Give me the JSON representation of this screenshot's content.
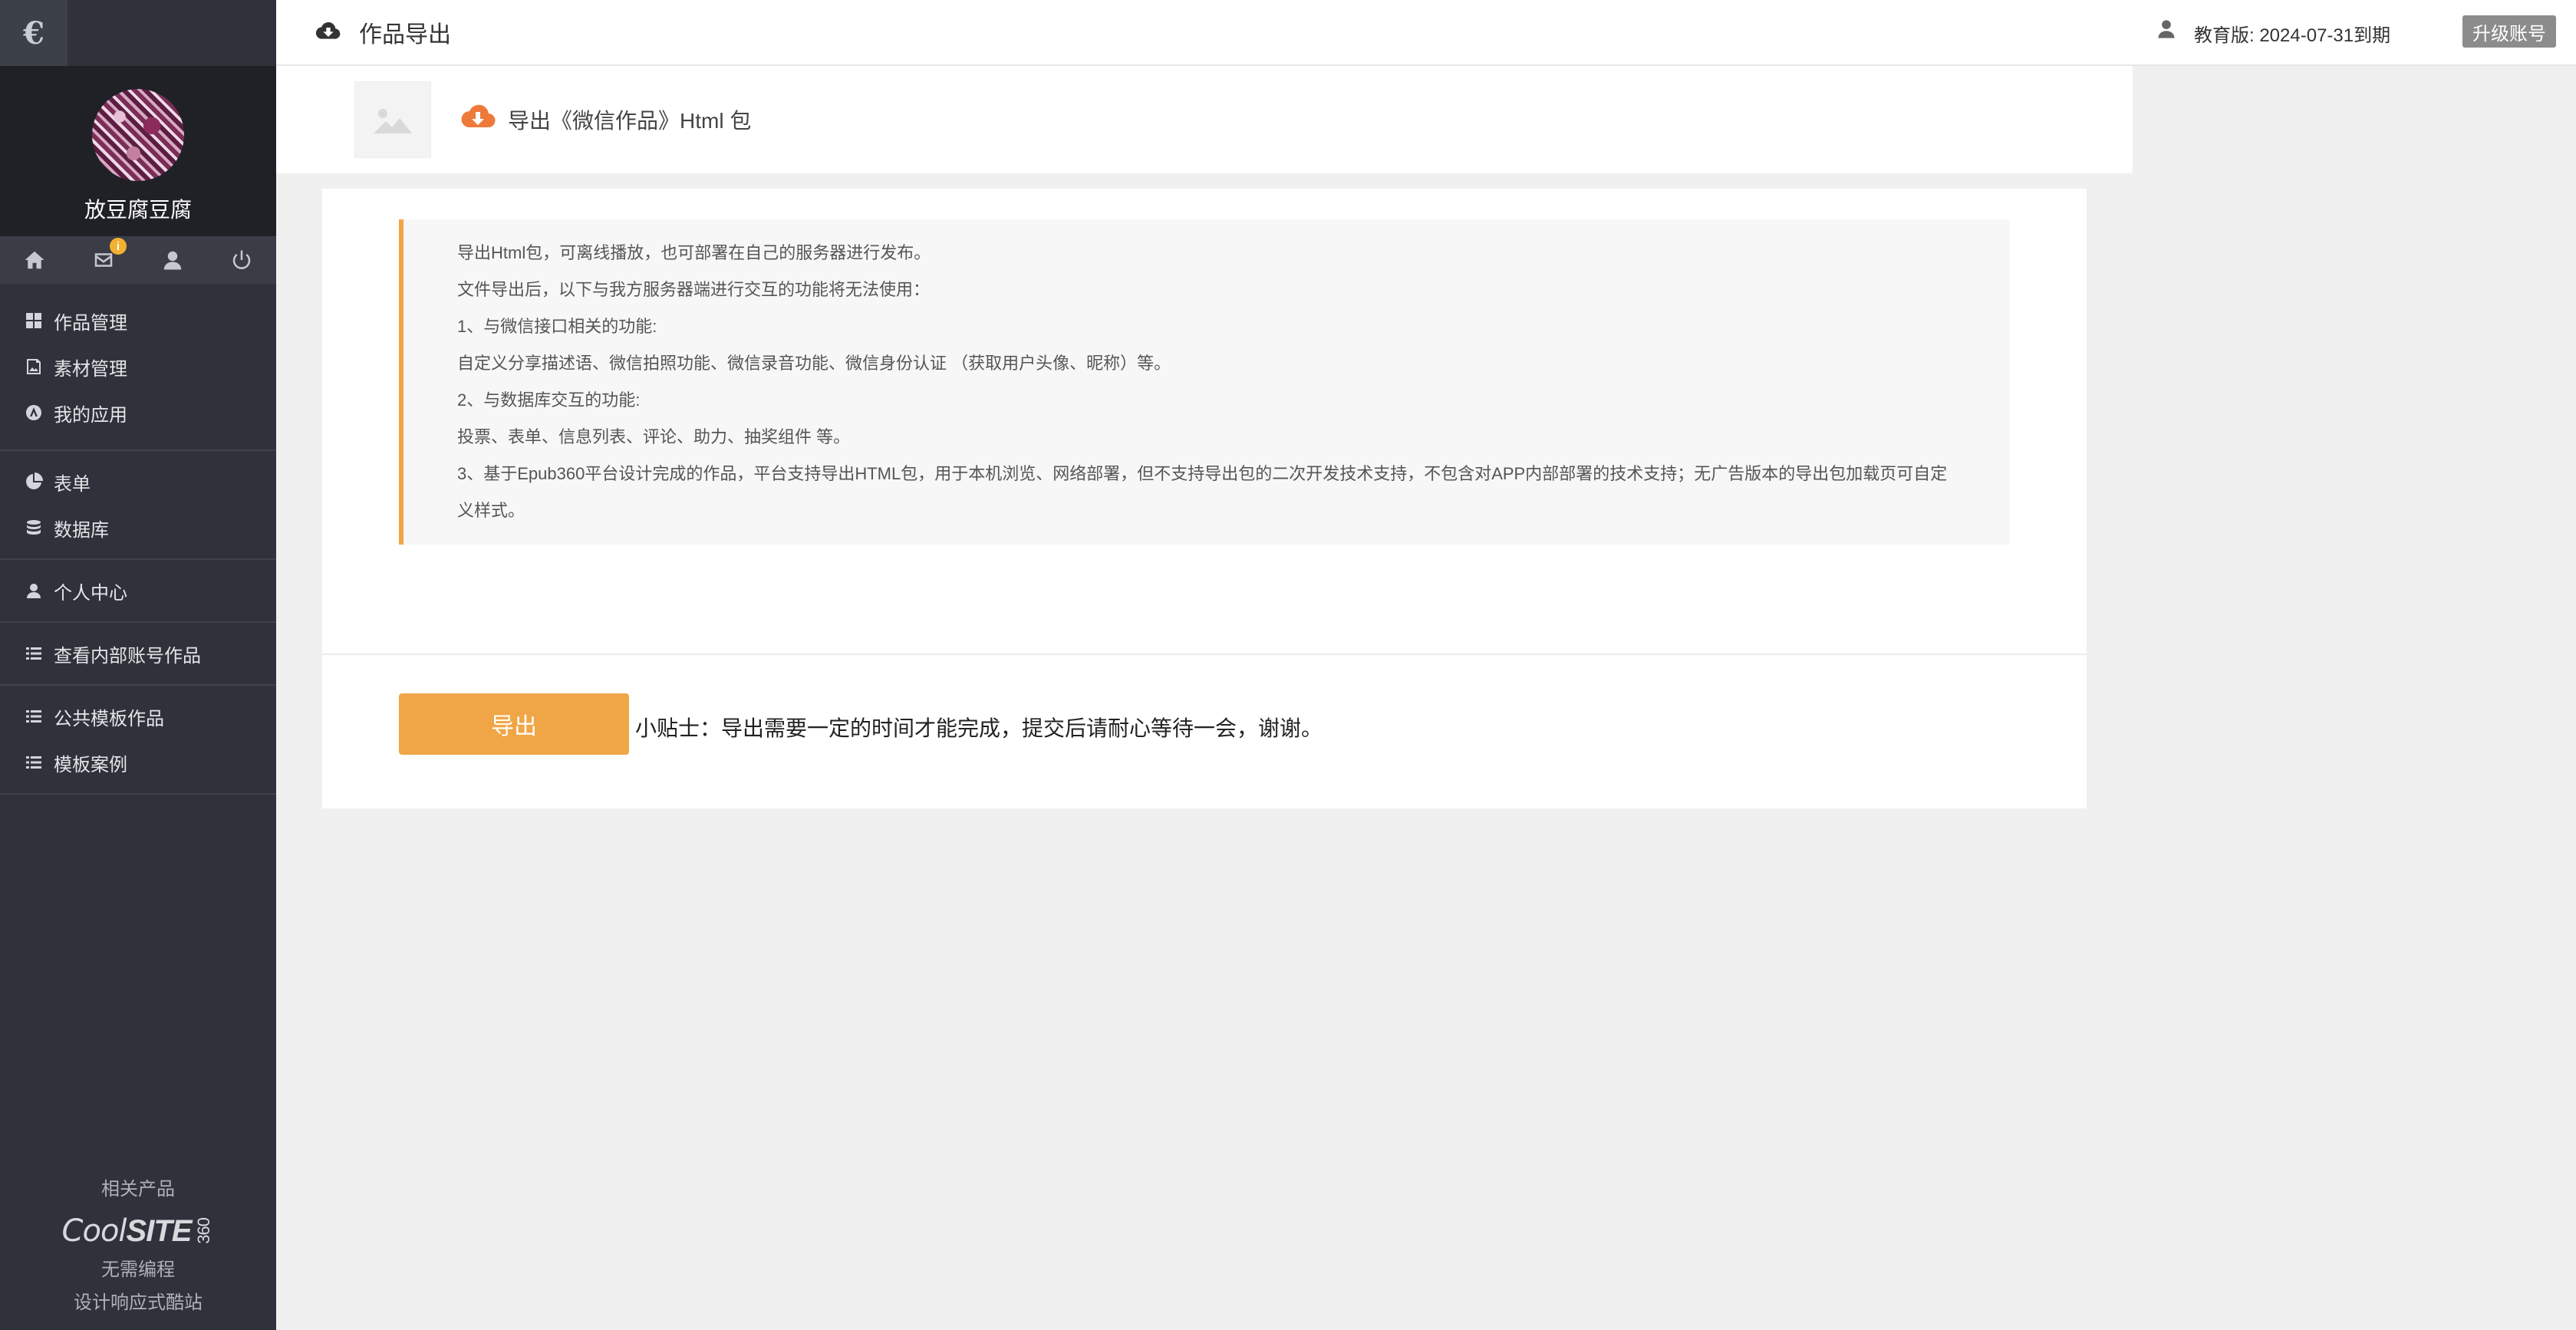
{
  "header": {
    "title": "作品导出",
    "edition": "教育版: 2024-07-31到期",
    "upgrade_label": "升级账号"
  },
  "sidebar": {
    "logo_glyph": "€",
    "username": "放豆腐豆腐",
    "mail_badge": "i",
    "groups": [
      [
        {
          "label": "作品管理",
          "icon": "grid-icon"
        },
        {
          "label": "素材管理",
          "icon": "image-icon"
        },
        {
          "label": "我的应用",
          "icon": "app-icon"
        }
      ],
      [
        {
          "label": "表单",
          "icon": "pie-chart-icon"
        },
        {
          "label": "数据库",
          "icon": "database-icon"
        }
      ],
      [
        {
          "label": "个人中心",
          "icon": "user-icon"
        }
      ],
      [
        {
          "label": "查看内部账号作品",
          "icon": "list-icon"
        }
      ],
      [
        {
          "label": "公共模板作品",
          "icon": "list-icon"
        },
        {
          "label": "模板案例",
          "icon": "list-icon"
        }
      ]
    ],
    "footer": {
      "related": "相关产品",
      "logo_cool": "Cool",
      "logo_site": "SITE",
      "logo_num": "360",
      "line1": "无需编程",
      "line2": "设计响应式酷站"
    }
  },
  "work": {
    "export_title": "导出《微信作品》Html 包"
  },
  "notice": {
    "lines": [
      "导出Html包，可离线播放，也可部署在自己的服务器进行发布。",
      "文件导出后，以下与我方服务器端进行交互的功能将无法使用：",
      "1、与微信接口相关的功能:",
      "自定义分享描述语、微信拍照功能、微信录音功能、微信身份认证 （获取用户头像、昵称）等。",
      "2、与数据库交互的功能:",
      "投票、表单、信息列表、评论、助力、抽奖组件 等。",
      "3、基于Epub360平台设计完成的作品，平台支持导出HTML包，用于本机浏览、网络部署，但不支持导出包的二次开发技术支持，不包含对APP内部部署的技术支持；无广告版本的导出包加载页可自定义样式。"
    ]
  },
  "actions": {
    "export_label": "导出",
    "tip": "小贴士：导出需要一定的时间才能完成，提交后请耐心等待一会，谢谢。"
  },
  "colors": {
    "accent": "#f0a646",
    "sidebar_bg": "#2f323a",
    "cloud_icon": "#ee7a3a"
  }
}
